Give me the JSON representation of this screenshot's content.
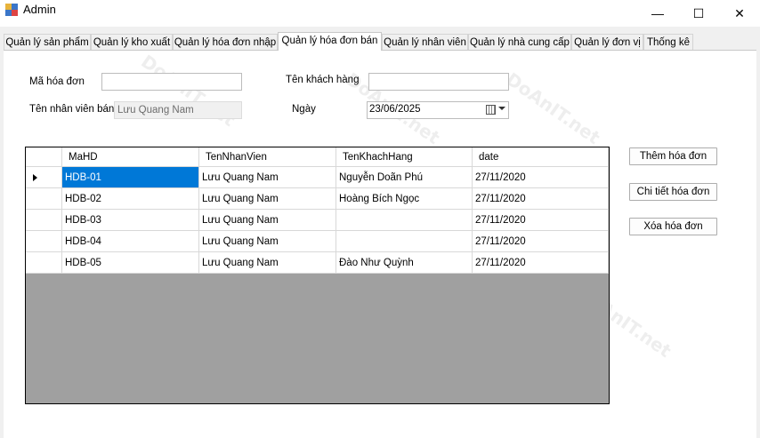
{
  "window": {
    "title": "Admin",
    "minimize": "—",
    "maximize": "☐",
    "close": "✕"
  },
  "tabs": [
    {
      "label": "Quản lý sản phẩm"
    },
    {
      "label": "Quản lý kho xuất"
    },
    {
      "label": "Quản lý hóa đơn nhập"
    },
    {
      "label": "Quản lý hóa đơn bán"
    },
    {
      "label": "Quản lý nhân viên"
    },
    {
      "label": "Quản lý nhà cung cấp"
    },
    {
      "label": "Quản lý đơn vị"
    },
    {
      "label": "Thống kê"
    }
  ],
  "form": {
    "ma_hoa_don_label": "Mã hóa đơn",
    "ma_hoa_don_value": "",
    "ten_khach_hang_label": "Tên khách hàng",
    "ten_khach_hang_value": "",
    "ten_nhan_vien_label": "Tên nhân viên bán",
    "ten_nhan_vien_value": "Lưu Quang Nam",
    "ngay_label": "Ngày",
    "ngay_value": "23/06/2025"
  },
  "grid": {
    "columns": [
      "MaHD",
      "TenNhanVien",
      "TenKhachHang",
      "date"
    ],
    "rows": [
      [
        "HDB-01",
        "Lưu Quang Nam",
        "Nguyễn Doãn Phú",
        "27/11/2020"
      ],
      [
        "HDB-02",
        "Lưu Quang Nam",
        "Hoàng Bích Ngọc",
        "27/11/2020"
      ],
      [
        "HDB-03",
        "Lưu Quang Nam",
        "",
        "27/11/2020"
      ],
      [
        "HDB-04",
        "Lưu Quang Nam",
        "",
        "27/11/2020"
      ],
      [
        "HDB-05",
        "Lưu Quang Nam",
        "Đào Như Quỳnh",
        "27/11/2020"
      ]
    ]
  },
  "buttons": {
    "them": "Thêm hóa đơn",
    "chi_tiet": "Chi tiết hóa đơn",
    "xoa": "Xóa hóa đơn"
  },
  "watermark": "DoAnIT.net"
}
